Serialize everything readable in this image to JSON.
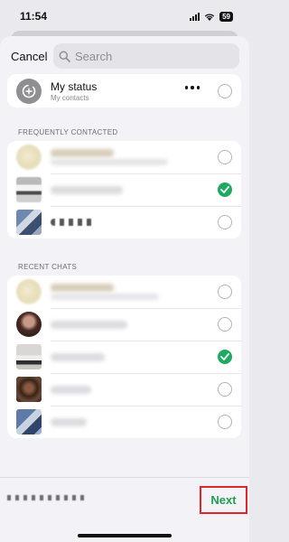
{
  "status_bar": {
    "time": "11:54",
    "battery": "59"
  },
  "header": {
    "cancel_label": "Cancel",
    "search_placeholder": "Search"
  },
  "my_status": {
    "title": "My status",
    "subtitle": "My contacts"
  },
  "sections": {
    "frequent_label": "FREQUENTLY CONTACTED",
    "recent_label": "RECENT CHATS"
  },
  "frequent_contacts": [
    {
      "checked": false
    },
    {
      "checked": true
    },
    {
      "checked": false
    }
  ],
  "recent_chats": [
    {
      "checked": false
    },
    {
      "checked": false
    },
    {
      "checked": true
    },
    {
      "checked": false
    },
    {
      "checked": false
    }
  ],
  "footer": {
    "next_label": "Next"
  },
  "colors": {
    "accent_green": "#1daa61",
    "highlight_red": "#e0262a"
  }
}
